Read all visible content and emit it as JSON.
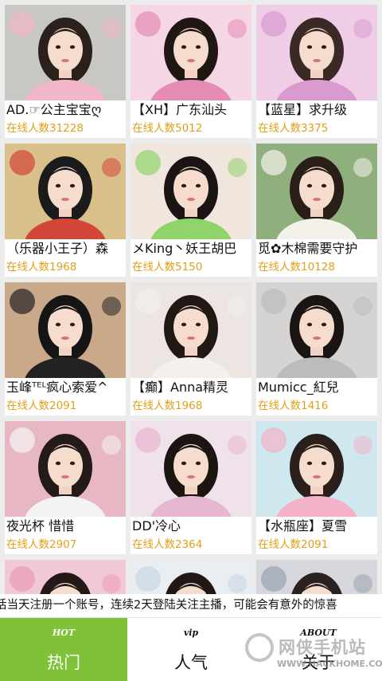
{
  "cards": [
    {
      "name": "AD.☞公主宝宝ღ",
      "count": "在线人数31228",
      "bg": "#c9c7c4",
      "accent": "#f1b6c8",
      "hair": "#2b211c"
    },
    {
      "name": "【XH】广东汕头",
      "count": "在线人数5012",
      "bg": "#f4d6e4",
      "accent": "#e58cb4",
      "hair": "#1e1714"
    },
    {
      "name": "【蓝星】求升级",
      "count": "在线人数3375",
      "bg": "#efcde6",
      "accent": "#d99ad0",
      "hair": "#3a2a26"
    },
    {
      "name": "（乐器小王子）森",
      "count": "在线人数1968",
      "bg": "#d9c08a",
      "accent": "#d2463a",
      "hair": "#1b1b1b"
    },
    {
      "name": "メKing丶妖王胡巴",
      "count": "在线人数5150",
      "bg": "#f1e6de",
      "accent": "#8fd36a",
      "hair": "#1a1513"
    },
    {
      "name": "觅✿木棉需要守护",
      "count": "在线人数10128",
      "bg": "#8fb07c",
      "accent": "#f4f1ea",
      "hair": "#2a1e18"
    },
    {
      "name": "玉峰ᵀᴱᴸ疯心索爱^",
      "count": "在线人数2091",
      "bg": "#c9a98a",
      "accent": "#222222",
      "hair": "#151515"
    },
    {
      "name": "【癫】Anna精灵",
      "count": "在线人数1968",
      "bg": "#ece5e1",
      "accent": "#f3f0ee",
      "hair": "#1f1815"
    },
    {
      "name": "Mumicc_紅兒",
      "count": "在线人数1416",
      "bg": "#d6d4d2",
      "accent": "#bcbcbc",
      "hair": "#1a1513"
    },
    {
      "name": "夜光杯 惜惜",
      "count": "在线人数2907",
      "bg": "#e7b8c4",
      "accent": "#f3f3f3",
      "hair": "#241a17"
    },
    {
      "name": "DD'冷心",
      "count": "在线人数2364",
      "bg": "#f0e2ea",
      "accent": "#e7b6d0",
      "hair": "#1c1512"
    },
    {
      "name": "【水瓶座】夏雪",
      "count": "在线人数2091",
      "bg": "#cfe8ef",
      "accent": "#f3b2c8",
      "hair": "#2a1f1b"
    },
    {
      "name": "",
      "count": "",
      "bg": "#f1c8d7",
      "accent": "#e89ab8",
      "hair": "#231a17"
    },
    {
      "name": "",
      "count": "",
      "bg": "#e9eef2",
      "accent": "#c7d6e4",
      "hair": "#201814"
    },
    {
      "name": "",
      "count": "",
      "bg": "#d6d7dc",
      "accent": "#9aa3b3",
      "hair": "#2a2220"
    }
  ],
  "marquee": "话当天注册一个账号，连续2天登陆关注主播，可能会有意外的惊喜",
  "tabs": [
    {
      "en": "HOT",
      "zh": "热门"
    },
    {
      "en": "vip",
      "zh": "人气"
    },
    {
      "en": "ABOUT",
      "zh": "关于"
    }
  ],
  "watermark": {
    "title": "网侠手机站",
    "url": "WWW.HACKHOME.COM"
  },
  "colors": {
    "active_tab": "#7fc23a",
    "count_text": "#e0a018"
  }
}
